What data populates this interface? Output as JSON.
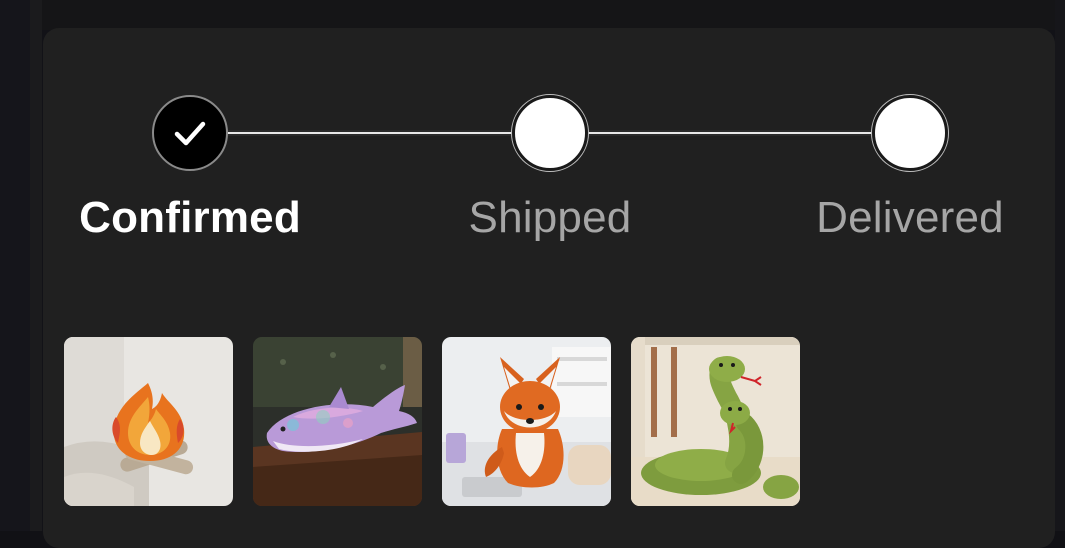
{
  "order_status": {
    "steps": [
      {
        "label": "Confirmed",
        "state": "complete",
        "icon": "checkmark-icon"
      },
      {
        "label": "Shipped",
        "state": "pending",
        "icon": ""
      },
      {
        "label": "Delivered",
        "state": "pending",
        "icon": ""
      }
    ]
  },
  "order_items": [
    {
      "icon": "campfire-plush-image"
    },
    {
      "icon": "purple-shark-plush-image"
    },
    {
      "icon": "fox-plush-image"
    },
    {
      "icon": "green-snake-plush-image"
    }
  ],
  "colors": {
    "card_background": "#202020",
    "complete_step": "#000000",
    "pending_step": "#ffffff",
    "active_label": "#ffffff",
    "inactive_label": "#a6a6a6"
  }
}
